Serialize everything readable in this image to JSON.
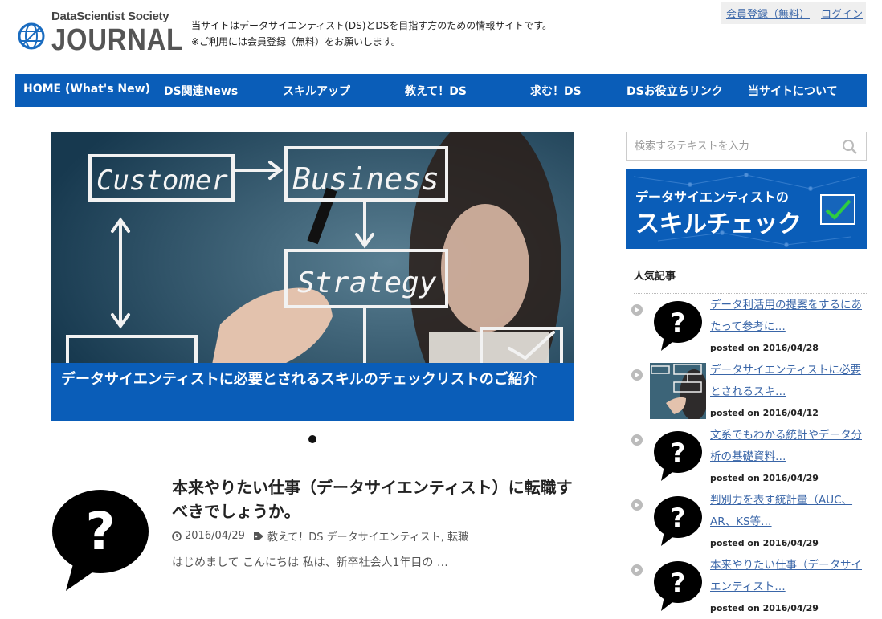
{
  "header": {
    "logo_top": "DataScientist Society",
    "logo_main": "JOURNAL",
    "tagline_line1": "当サイトはデータサイエンティスト(DS)とDSを目指す方のための情報サイトです。",
    "tagline_line2": "※ご利用には会員登録（無料）をお願いします。",
    "register_link": "会員登録（無料）",
    "login_link": "ログイン"
  },
  "nav": {
    "items": [
      {
        "label": "HOME (What's New)"
      },
      {
        "label": "DS関連News"
      },
      {
        "label": "スキルアップ"
      },
      {
        "label": "教えて！DS"
      },
      {
        "label": "求む！DS"
      },
      {
        "label": "DSお役立ちリンク"
      },
      {
        "label": "当サイトについて"
      }
    ]
  },
  "slider": {
    "image_words": [
      "Customer",
      "Business",
      "Strategy"
    ],
    "caption": "データサイエンティストに必要とされるスキルのチェックリストのご紹介"
  },
  "article": {
    "title": "本来やりたい仕事（データサイエンティスト）に転職すべきでしょうか。",
    "date": "2016/04/29",
    "categories": "教えて！DS データサイエンティスト, 転職",
    "excerpt": "はじめまして こんにちは 私は、新卒社会人1年目の …"
  },
  "sidebar": {
    "search_placeholder": "検索するテキストを入力",
    "banner_line1": "データサイエンティストの",
    "banner_line2": "スキルチェック",
    "popular_heading": "人気記事",
    "popular": [
      {
        "title": "データ利活用の提案をするにあたって参考に…",
        "date": "posted on 2016/04/28",
        "thumb": "question"
      },
      {
        "title": "データサイエンティストに必要とされるスキ…",
        "date": "posted on 2016/04/12",
        "thumb": "whiteboard"
      },
      {
        "title": "文系でもわかる統計やデータ分析の基礎資料…",
        "date": "posted on 2016/04/29",
        "thumb": "question"
      },
      {
        "title": "判別力を表す統計量（AUC、AR、KS等…",
        "date": "posted on 2016/04/29",
        "thumb": "question"
      },
      {
        "title": "本来やりたい仕事（データサイエンティスト…",
        "date": "posted on 2016/04/29",
        "thumb": "question"
      }
    ]
  },
  "colors": {
    "nav_bg": "#0a5db8",
    "link": "#3a66a8",
    "banner_check": "#2ecc40"
  },
  "icons": [
    "globe-icon",
    "search-icon",
    "clock-icon",
    "tag-icon",
    "chevron-right-icon",
    "question-bubble-icon",
    "checkmark-icon"
  ]
}
